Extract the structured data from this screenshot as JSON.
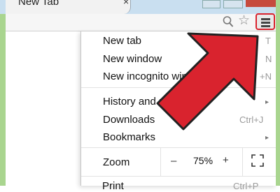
{
  "tab": {
    "title": "New Tab",
    "close": "×"
  },
  "toolbar": {
    "zoom_icon": "zoom-icon",
    "star_icon": "☆",
    "menu_icon": "hamburger-menu-icon"
  },
  "menu": {
    "items": [
      {
        "label": "New tab",
        "shortcut": "T"
      },
      {
        "label": "New window",
        "shortcut": "N"
      },
      {
        "label": "New incognito windo",
        "shortcut": "+N"
      },
      {
        "label": "History and recent",
        "arrow": "▸"
      },
      {
        "label": "Downloads",
        "shortcut": "Ctrl+J"
      },
      {
        "label": "Bookmarks",
        "arrow": "▸"
      }
    ],
    "zoom": {
      "label": "Zoom",
      "minus": "–",
      "value": "75%",
      "plus": "+"
    },
    "print": {
      "label": "Print",
      "shortcut": "Ctrl+P"
    }
  },
  "colors": {
    "accent_arrow": "#d9232e",
    "frame": "#a9d58f"
  }
}
